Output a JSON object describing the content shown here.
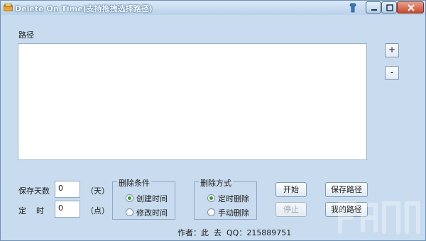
{
  "window": {
    "title": "Delete On Time(支持拖拽选择路径)"
  },
  "path_section": {
    "label": "路径",
    "add_label": "+",
    "remove_label": "-"
  },
  "days": {
    "label": "保存天数",
    "value": "0",
    "unit": "（天）"
  },
  "timer": {
    "label": "定    时",
    "value": "0",
    "unit": "（点）"
  },
  "condition": {
    "title": "删除条件",
    "options": [
      {
        "label": "创建时间",
        "selected": true
      },
      {
        "label": "修改时间",
        "selected": false
      }
    ]
  },
  "mode": {
    "title": "删除方式",
    "options": [
      {
        "label": "定时删除",
        "selected": true
      },
      {
        "label": "手动删除",
        "selected": false
      }
    ]
  },
  "actions": {
    "start_label": "开始",
    "stop_label": "停止",
    "save_path_label": "保存路径",
    "my_path_label": "我的路径"
  },
  "footer": {
    "author": "作者：此  去",
    "qq": "QQ：215889751"
  },
  "colors": {
    "window_bg": "#c9dcef",
    "title_bar": "#b9d1ea",
    "close_button": "#c74a2c",
    "radio_selected": "#2f9a2f"
  }
}
